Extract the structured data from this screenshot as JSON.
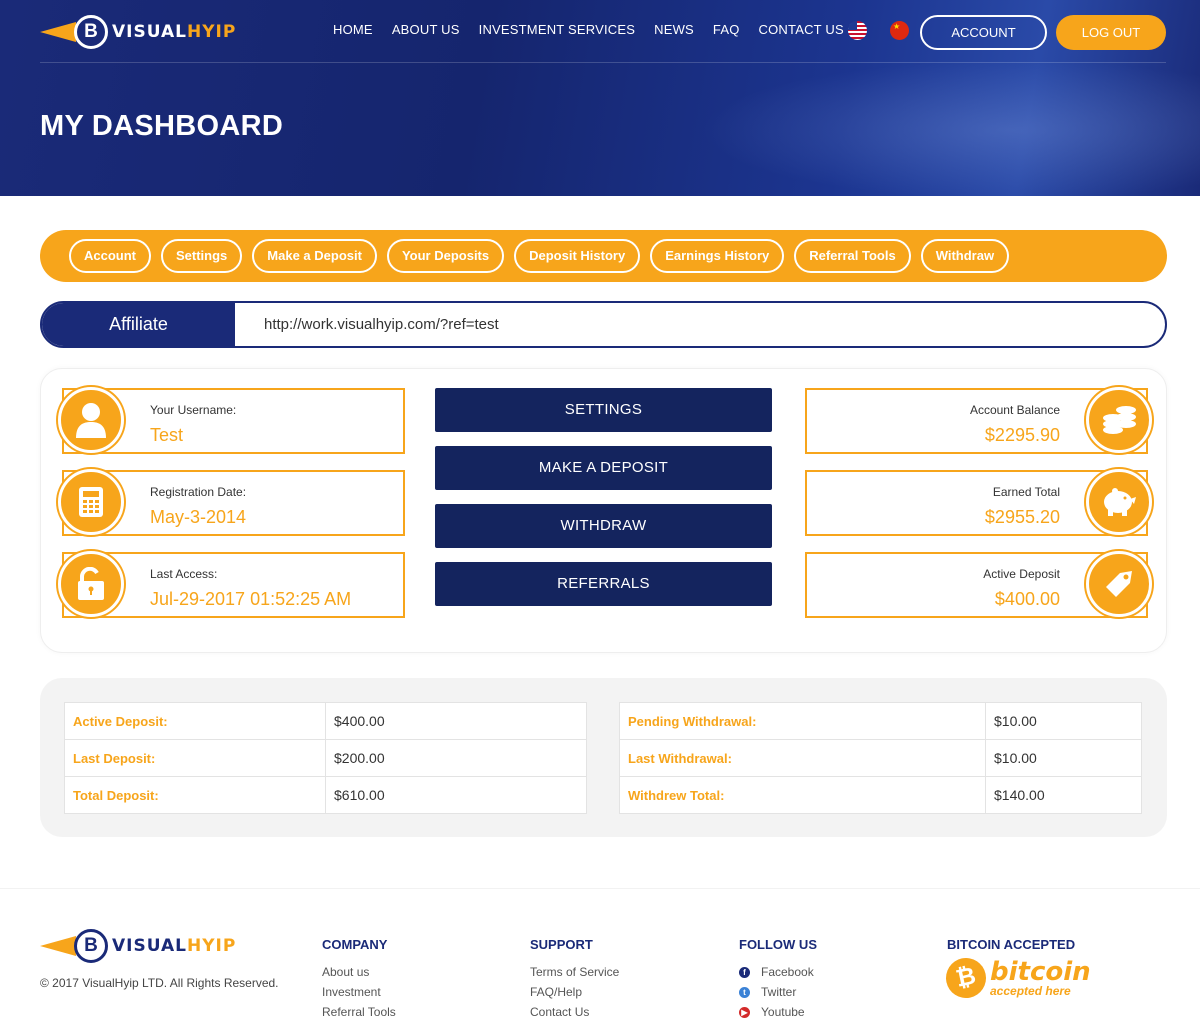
{
  "brand": {
    "name_part1": "VISUAL",
    "name_part2": "HYIP",
    "coin_symbol": "B"
  },
  "nav": {
    "items": [
      "HOME",
      "ABOUT US",
      "INVESTMENT SERVICES",
      "NEWS",
      "FAQ",
      "CONTACT US"
    ],
    "account_label": "ACCOUNT",
    "logout_label": "LOG OUT"
  },
  "page": {
    "title": "MY DASHBOARD"
  },
  "tabs": [
    "Account",
    "Settings",
    "Make a Deposit",
    "Your Deposits",
    "Deposit History",
    "Earnings History",
    "Referral Tools",
    "Withdraw"
  ],
  "affiliate": {
    "label": "Affiliate",
    "url": "http://work.visualhyip.com/?ref=test"
  },
  "user_cards": [
    {
      "label": "Your Username:",
      "value": "Test",
      "icon": "user-icon"
    },
    {
      "label": "Registration Date:",
      "value": "May-3-2014",
      "icon": "calculator-icon"
    },
    {
      "label": "Last Access:",
      "value": "Jul-29-2017 01:52:25 AM",
      "icon": "unlock-icon"
    }
  ],
  "actions": [
    "SETTINGS",
    "MAKE A DEPOSIT",
    "WITHDRAW",
    "REFERRALS"
  ],
  "money_cards": [
    {
      "label": "Account Balance",
      "value": "$2295.90",
      "icon": "coins-icon"
    },
    {
      "label": "Earned Total",
      "value": "$2955.20",
      "icon": "piggy-bank-icon"
    },
    {
      "label": "Active Deposit",
      "value": "$400.00",
      "icon": "price-tag-icon"
    }
  ],
  "deposit_totals": [
    {
      "key": "Active Deposit:",
      "value": "$400.00"
    },
    {
      "key": "Last Deposit:",
      "value": "$200.00"
    },
    {
      "key": "Total Deposit:",
      "value": "$610.00"
    }
  ],
  "withdraw_totals": [
    {
      "key": "Pending Withdrawal:",
      "value": "$10.00"
    },
    {
      "key": "Last Withdrawal:",
      "value": "$10.00"
    },
    {
      "key": "Withdrew Total:",
      "value": "$140.00"
    }
  ],
  "footer": {
    "copyright": "© 2017 VisualHyip LTD. All Rights Reserved.",
    "company": {
      "title": "COMPANY",
      "links": [
        "About us",
        "Investment",
        "Referral Tools"
      ]
    },
    "support": {
      "title": "SUPPORT",
      "links": [
        "Terms of Service",
        "FAQ/Help",
        "Contact Us"
      ]
    },
    "follow": {
      "title": "FOLLOW US",
      "links": [
        "Facebook",
        "Twitter",
        "Youtube"
      ]
    },
    "bitcoin": {
      "title": "BITCOIN ACCEPTED",
      "word": "bitcoin",
      "sub": "accepted here"
    }
  },
  "colors": {
    "accent": "#f7a51b",
    "navy": "#1a2a78",
    "dark_navy": "#14245e"
  }
}
